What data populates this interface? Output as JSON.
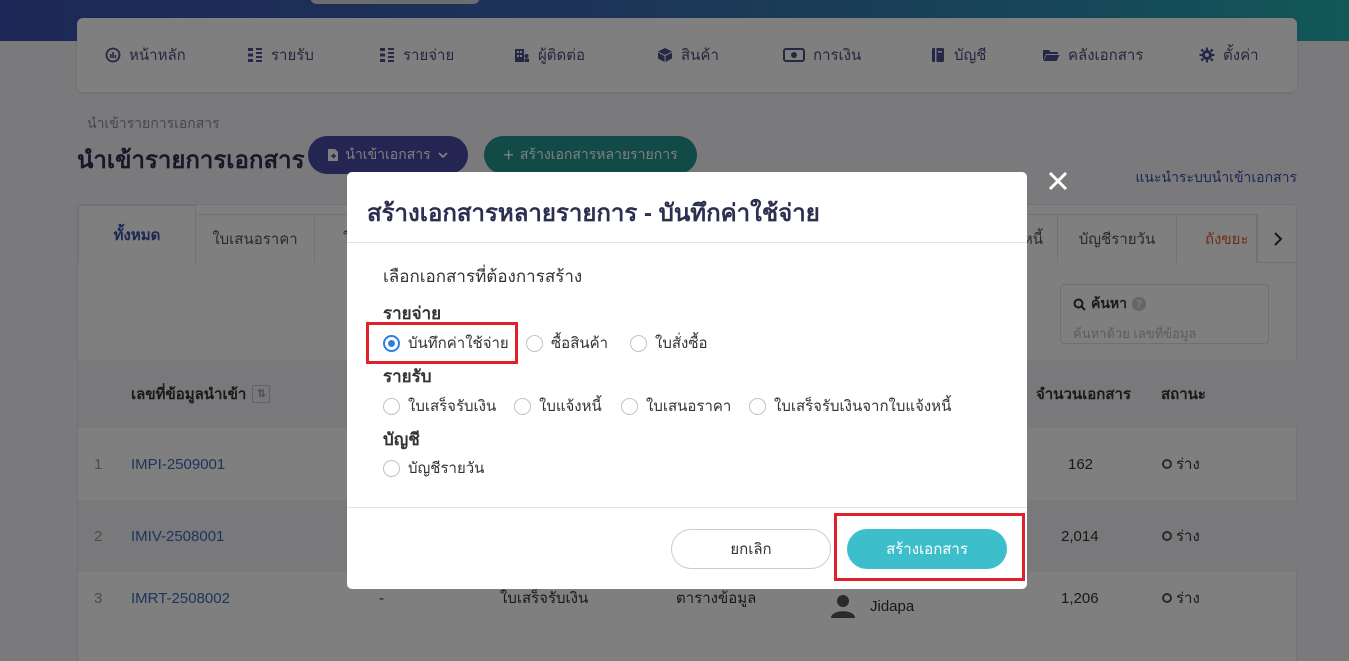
{
  "nav": {
    "items": [
      {
        "label": "หน้าหลัก",
        "icon": "dashboard-icon"
      },
      {
        "label": "รายรับ",
        "icon": "income-icon"
      },
      {
        "label": "รายจ่าย",
        "icon": "expense-icon"
      },
      {
        "label": "ผู้ติดต่อ",
        "icon": "contacts-icon"
      },
      {
        "label": "สินค้า",
        "icon": "box-icon"
      },
      {
        "label": "การเงิน",
        "icon": "money-icon"
      },
      {
        "label": "บัญชี",
        "icon": "ledger-icon"
      },
      {
        "label": "คลังเอกสาร",
        "icon": "folder-icon"
      },
      {
        "label": "ตั้งค่า",
        "icon": "gear-icon"
      }
    ]
  },
  "page": {
    "breadcrumb": "นำเข้ารายการเอกสาร",
    "title": "นำเข้ารายการเอกสาร",
    "import_button": "นำเข้าเอกสาร",
    "create_multi_button": "สร้างเอกสารหลายรายการ",
    "help_link": "แนะนำระบบนำเข้าเอกสาร"
  },
  "tabs": {
    "items": [
      "ทั้งหมด",
      "ใบเสนอราคา",
      "ใ",
      "หนี้",
      "บัญชีรายวัน",
      "ถังขยะ"
    ]
  },
  "search": {
    "title": "ค้นหา",
    "help": "?",
    "placeholder": "ค้นหาด้วย เลขที่ข้อมูล"
  },
  "table": {
    "headers": {
      "id": "เลขที่ข้อมูลนำเข้า",
      "count": "จำนวนเอกสาร",
      "status": "สถานะ"
    },
    "rows": [
      {
        "index": "1",
        "id": "IMPI-2509001",
        "dash": "",
        "type": "",
        "source": "",
        "user": "",
        "count": "162",
        "status": "ร่าง"
      },
      {
        "index": "2",
        "id": "IMIV-2508001",
        "dash": "",
        "type": "",
        "source": "",
        "user": "",
        "count": "2,014",
        "status": "ร่าง"
      },
      {
        "index": "3",
        "id": "IMRT-2508002",
        "dash": "-",
        "type": "ใบเสร็จรับเงิน",
        "source": "ตารางข้อมูล",
        "user": "Jidapa",
        "count": "1,206",
        "status": "ร่าง"
      }
    ]
  },
  "modal": {
    "title": "สร้างเอกสารหลายรายการ - บันทึกค่าใช้จ่าย",
    "subtitle": "เลือกเอกสารที่ต้องการสร้าง",
    "groups": {
      "expense": {
        "label": "รายจ่าย",
        "options": [
          "บันทึกค่าใช้จ่าย",
          "ซื้อสินค้า",
          "ใบสั่งซื้อ"
        ]
      },
      "income": {
        "label": "รายรับ",
        "options": [
          "ใบเสร็จรับเงิน",
          "ใบแจ้งหนี้",
          "ใบเสนอราคา",
          "ใบเสร็จรับเงินจากใบแจ้งหนี้"
        ]
      },
      "account": {
        "label": "บัญชี",
        "options": [
          "บัญชีรายวัน"
        ]
      }
    },
    "selected": "บันทึกค่าใช้จ่าย",
    "cancel": "ยกเลิก",
    "submit": "สร้างเอกสาร",
    "close": "✕"
  },
  "colors": {
    "primary": "#4a4aa6",
    "teal": "#23958c",
    "submit": "#3dbfcb",
    "radio_checked": "#2d7fe0",
    "highlight": "#e0202a"
  }
}
